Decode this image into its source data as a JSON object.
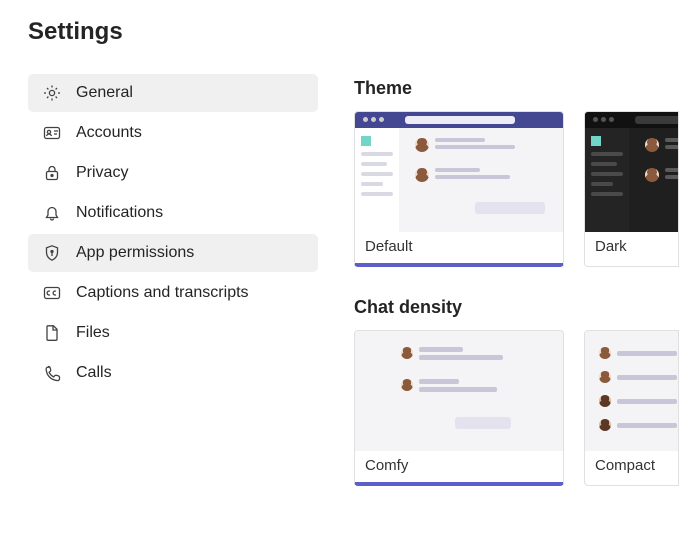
{
  "title": "Settings",
  "sidebar": {
    "items": [
      {
        "label": "General",
        "icon": "gear",
        "selected": true
      },
      {
        "label": "Accounts",
        "icon": "id-card",
        "selected": false
      },
      {
        "label": "Privacy",
        "icon": "lock",
        "selected": false
      },
      {
        "label": "Notifications",
        "icon": "bell",
        "selected": false
      },
      {
        "label": "App permissions",
        "icon": "shield",
        "selected": true
      },
      {
        "label": "Captions and transcripts",
        "icon": "cc",
        "selected": false
      },
      {
        "label": "Files",
        "icon": "file",
        "selected": false
      },
      {
        "label": "Calls",
        "icon": "phone",
        "selected": false
      }
    ]
  },
  "sections": {
    "theme": {
      "title": "Theme",
      "options": [
        {
          "label": "Default",
          "selected": true
        },
        {
          "label": "Dark",
          "selected": false
        }
      ]
    },
    "chat_density": {
      "title": "Chat density",
      "options": [
        {
          "label": "Comfy",
          "selected": true
        },
        {
          "label": "Compact",
          "selected": false
        }
      ]
    }
  },
  "colors": {
    "accent": "#5b5fc7",
    "header_bar": "#444791"
  }
}
